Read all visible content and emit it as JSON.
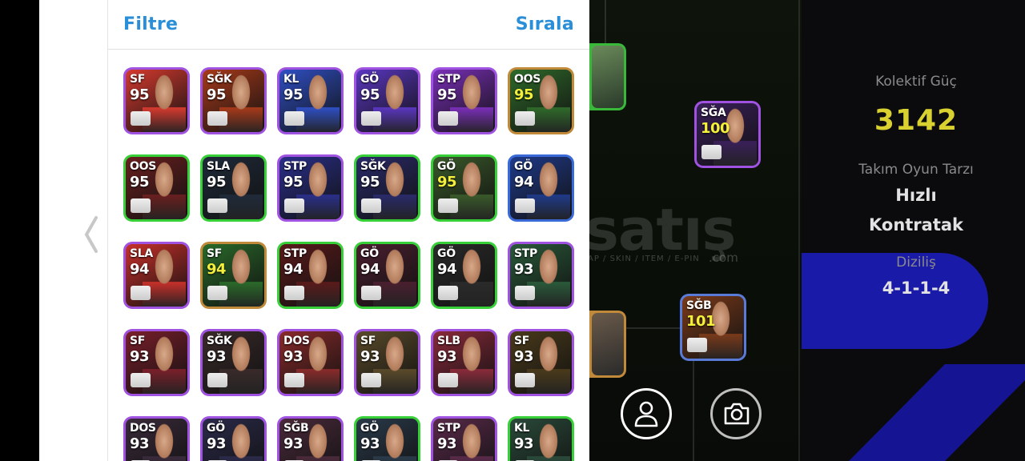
{
  "header": {
    "filter_label": "Filtre",
    "sort_label": "Sırala"
  },
  "cards": [
    {
      "pos": "SF",
      "rating": "95",
      "border": "#a052e0",
      "bg": "#d63a2f",
      "gold": false
    },
    {
      "pos": "SĞK",
      "rating": "95",
      "border": "#a052e0",
      "bg": "#a83a1a",
      "gold": false
    },
    {
      "pos": "KL",
      "rating": "95",
      "border": "#a052e0",
      "bg": "#2f4fc4",
      "gold": false
    },
    {
      "pos": "GÖ",
      "rating": "95",
      "border": "#a052e0",
      "bg": "#5a36c0",
      "gold": false
    },
    {
      "pos": "STP",
      "rating": "95",
      "border": "#a052e0",
      "bg": "#7a2fb8",
      "gold": false
    },
    {
      "pos": "OOS",
      "rating": "95",
      "border": "#c08a3a",
      "bg": "#2f6a2a",
      "gold": true
    },
    {
      "pos": "OOS",
      "rating": "95",
      "border": "#38d038",
      "bg": "#6a1f1f",
      "gold": false
    },
    {
      "pos": "SLA",
      "rating": "95",
      "border": "#38d038",
      "bg": "#1f2a3a",
      "gold": false
    },
    {
      "pos": "STP",
      "rating": "95",
      "border": "#a052e0",
      "bg": "#2a2f8a",
      "gold": false
    },
    {
      "pos": "SĞK",
      "rating": "95",
      "border": "#38d038",
      "bg": "#2a2a6a",
      "gold": false
    },
    {
      "pos": "GÖ",
      "rating": "95",
      "border": "#38d038",
      "bg": "#3a5a2a",
      "gold": true
    },
    {
      "pos": "GÖ",
      "rating": "94",
      "border": "#3a6ad8",
      "bg": "#1f3a8a",
      "gold": false
    },
    {
      "pos": "SLA",
      "rating": "94",
      "border": "#a052e0",
      "bg": "#c8302a",
      "gold": false
    },
    {
      "pos": "SF",
      "rating": "94",
      "border": "#c08a3a",
      "bg": "#2a6a2a",
      "gold": true
    },
    {
      "pos": "STP",
      "rating": "94",
      "border": "#38d038",
      "bg": "#5a1a1a",
      "gold": false
    },
    {
      "pos": "GÖ",
      "rating": "94",
      "border": "#38d038",
      "bg": "#4a1f2f",
      "gold": false
    },
    {
      "pos": "GÖ",
      "rating": "94",
      "border": "#38d038",
      "bg": "#2a2a2a",
      "gold": false
    },
    {
      "pos": "STP",
      "rating": "93",
      "border": "#a052e0",
      "bg": "#2a5a3a",
      "gold": false
    },
    {
      "pos": "SF",
      "rating": "93",
      "border": "#a052e0",
      "bg": "#7a1f2a",
      "gold": false
    },
    {
      "pos": "SĞK",
      "rating": "93",
      "border": "#a052e0",
      "bg": "#3a2a2a",
      "gold": false
    },
    {
      "pos": "DOS",
      "rating": "93",
      "border": "#a052e0",
      "bg": "#8a2a2a",
      "gold": false
    },
    {
      "pos": "SF",
      "rating": "93",
      "border": "#a052e0",
      "bg": "#5a4a2a",
      "gold": false
    },
    {
      "pos": "SLB",
      "rating": "93",
      "border": "#a052e0",
      "bg": "#8a2a3a",
      "gold": false
    },
    {
      "pos": "SF",
      "rating": "93",
      "border": "#a052e0",
      "bg": "#4a3a1a",
      "gold": false
    },
    {
      "pos": "DOS",
      "rating": "93",
      "border": "#a052e0",
      "bg": "#3a2a3a",
      "gold": false
    },
    {
      "pos": "GÖ",
      "rating": "93",
      "border": "#a052e0",
      "bg": "#2a2a4a",
      "gold": false
    },
    {
      "pos": "SĞB",
      "rating": "93",
      "border": "#a052e0",
      "bg": "#4a2a3a",
      "gold": false
    },
    {
      "pos": "GÖ",
      "rating": "93",
      "border": "#38d038",
      "bg": "#2a3a4a",
      "gold": false
    },
    {
      "pos": "STP",
      "rating": "93",
      "border": "#a052e0",
      "bg": "#5a2a4a",
      "gold": false
    },
    {
      "pos": "KL",
      "rating": "93",
      "border": "#38d038",
      "bg": "#2a4a3a",
      "gold": false
    }
  ],
  "formation_cards": [
    {
      "pos": "SĞA",
      "rating": "100",
      "border": "#a052e0",
      "bg": "#3a1f5a",
      "gold": true
    },
    {
      "pos": "SĞB",
      "rating": "101",
      "border": "#5a7ad8",
      "bg": "#7a3a1a",
      "gold": true
    }
  ],
  "watermark": {
    "main": "satış",
    "sub": "AP / SKIN / ITEM / E-PIN",
    "com": ".com"
  },
  "stats": {
    "power_label": "Kolektif Güç",
    "power_value": "3142",
    "style_label": "Takım Oyun Tarzı",
    "style_line1": "Hızlı",
    "style_line2": "Kontratak",
    "formation_label": "Diziliş",
    "formation_value": "4-1-1-4"
  },
  "icons": {
    "back": "chevron-left-icon",
    "profile": "person-icon",
    "camera": "camera-icon"
  }
}
